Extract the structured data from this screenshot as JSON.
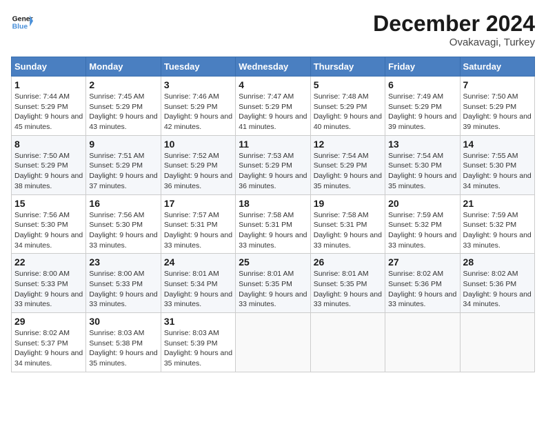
{
  "header": {
    "logo_line1": "General",
    "logo_line2": "Blue",
    "month": "December 2024",
    "location": "Ovakavagi, Turkey"
  },
  "weekdays": [
    "Sunday",
    "Monday",
    "Tuesday",
    "Wednesday",
    "Thursday",
    "Friday",
    "Saturday"
  ],
  "weeks": [
    [
      {
        "day": "1",
        "sunrise": "7:44 AM",
        "sunset": "5:29 PM",
        "daylight": "9 hours and 45 minutes."
      },
      {
        "day": "2",
        "sunrise": "7:45 AM",
        "sunset": "5:29 PM",
        "daylight": "9 hours and 43 minutes."
      },
      {
        "day": "3",
        "sunrise": "7:46 AM",
        "sunset": "5:29 PM",
        "daylight": "9 hours and 42 minutes."
      },
      {
        "day": "4",
        "sunrise": "7:47 AM",
        "sunset": "5:29 PM",
        "daylight": "9 hours and 41 minutes."
      },
      {
        "day": "5",
        "sunrise": "7:48 AM",
        "sunset": "5:29 PM",
        "daylight": "9 hours and 40 minutes."
      },
      {
        "day": "6",
        "sunrise": "7:49 AM",
        "sunset": "5:29 PM",
        "daylight": "9 hours and 39 minutes."
      },
      {
        "day": "7",
        "sunrise": "7:50 AM",
        "sunset": "5:29 PM",
        "daylight": "9 hours and 39 minutes."
      }
    ],
    [
      {
        "day": "8",
        "sunrise": "7:50 AM",
        "sunset": "5:29 PM",
        "daylight": "9 hours and 38 minutes."
      },
      {
        "day": "9",
        "sunrise": "7:51 AM",
        "sunset": "5:29 PM",
        "daylight": "9 hours and 37 minutes."
      },
      {
        "day": "10",
        "sunrise": "7:52 AM",
        "sunset": "5:29 PM",
        "daylight": "9 hours and 36 minutes."
      },
      {
        "day": "11",
        "sunrise": "7:53 AM",
        "sunset": "5:29 PM",
        "daylight": "9 hours and 36 minutes."
      },
      {
        "day": "12",
        "sunrise": "7:54 AM",
        "sunset": "5:29 PM",
        "daylight": "9 hours and 35 minutes."
      },
      {
        "day": "13",
        "sunrise": "7:54 AM",
        "sunset": "5:30 PM",
        "daylight": "9 hours and 35 minutes."
      },
      {
        "day": "14",
        "sunrise": "7:55 AM",
        "sunset": "5:30 PM",
        "daylight": "9 hours and 34 minutes."
      }
    ],
    [
      {
        "day": "15",
        "sunrise": "7:56 AM",
        "sunset": "5:30 PM",
        "daylight": "9 hours and 34 minutes."
      },
      {
        "day": "16",
        "sunrise": "7:56 AM",
        "sunset": "5:30 PM",
        "daylight": "9 hours and 33 minutes."
      },
      {
        "day": "17",
        "sunrise": "7:57 AM",
        "sunset": "5:31 PM",
        "daylight": "9 hours and 33 minutes."
      },
      {
        "day": "18",
        "sunrise": "7:58 AM",
        "sunset": "5:31 PM",
        "daylight": "9 hours and 33 minutes."
      },
      {
        "day": "19",
        "sunrise": "7:58 AM",
        "sunset": "5:31 PM",
        "daylight": "9 hours and 33 minutes."
      },
      {
        "day": "20",
        "sunrise": "7:59 AM",
        "sunset": "5:32 PM",
        "daylight": "9 hours and 33 minutes."
      },
      {
        "day": "21",
        "sunrise": "7:59 AM",
        "sunset": "5:32 PM",
        "daylight": "9 hours and 33 minutes."
      }
    ],
    [
      {
        "day": "22",
        "sunrise": "8:00 AM",
        "sunset": "5:33 PM",
        "daylight": "9 hours and 33 minutes."
      },
      {
        "day": "23",
        "sunrise": "8:00 AM",
        "sunset": "5:33 PM",
        "daylight": "9 hours and 33 minutes."
      },
      {
        "day": "24",
        "sunrise": "8:01 AM",
        "sunset": "5:34 PM",
        "daylight": "9 hours and 33 minutes."
      },
      {
        "day": "25",
        "sunrise": "8:01 AM",
        "sunset": "5:35 PM",
        "daylight": "9 hours and 33 minutes."
      },
      {
        "day": "26",
        "sunrise": "8:01 AM",
        "sunset": "5:35 PM",
        "daylight": "9 hours and 33 minutes."
      },
      {
        "day": "27",
        "sunrise": "8:02 AM",
        "sunset": "5:36 PM",
        "daylight": "9 hours and 33 minutes."
      },
      {
        "day": "28",
        "sunrise": "8:02 AM",
        "sunset": "5:36 PM",
        "daylight": "9 hours and 34 minutes."
      }
    ],
    [
      {
        "day": "29",
        "sunrise": "8:02 AM",
        "sunset": "5:37 PM",
        "daylight": "9 hours and 34 minutes."
      },
      {
        "day": "30",
        "sunrise": "8:03 AM",
        "sunset": "5:38 PM",
        "daylight": "9 hours and 35 minutes."
      },
      {
        "day": "31",
        "sunrise": "8:03 AM",
        "sunset": "5:39 PM",
        "daylight": "9 hours and 35 minutes."
      },
      null,
      null,
      null,
      null
    ]
  ],
  "labels": {
    "sunrise": "Sunrise:",
    "sunset": "Sunset:",
    "daylight": "Daylight:"
  }
}
